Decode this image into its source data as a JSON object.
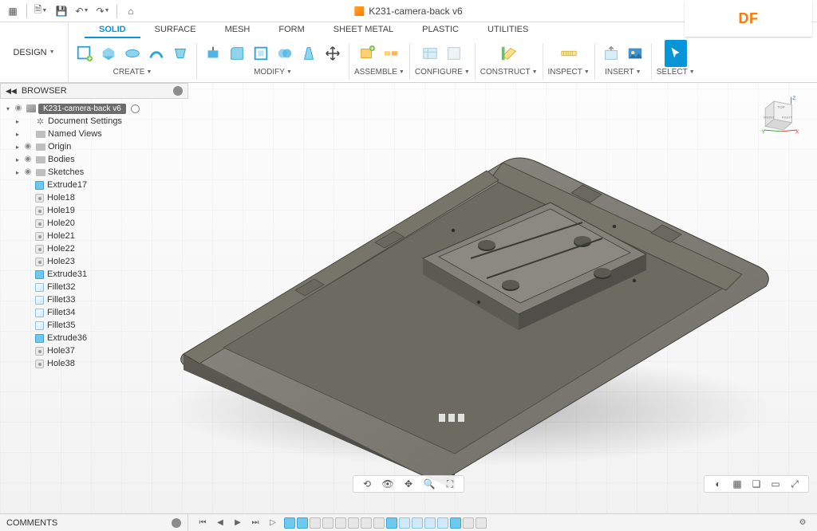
{
  "title": "K231-camera-back v6",
  "brand": "DF",
  "design_label": "DESIGN",
  "tabs": [
    "SOLID",
    "SURFACE",
    "MESH",
    "FORM",
    "SHEET METAL",
    "PLASTIC",
    "UTILITIES"
  ],
  "active_tab": 0,
  "groups": {
    "create": "CREATE",
    "modify": "MODIFY",
    "assemble": "ASSEMBLE",
    "configure": "CONFIGURE",
    "construct": "CONSTRUCT",
    "inspect": "INSPECT",
    "insert": "INSERT",
    "select": "SELECT"
  },
  "browser": {
    "title": "BROWSER",
    "root": "K231-camera-back v6",
    "nodes": [
      {
        "icon": "gear",
        "label": "Document Settings",
        "lvl": 1,
        "tri": true
      },
      {
        "icon": "folder",
        "label": "Named Views",
        "lvl": 1,
        "tri": true
      },
      {
        "icon": "folder",
        "label": "Origin",
        "lvl": 1,
        "tri": true,
        "eye": true
      },
      {
        "icon": "folder",
        "label": "Bodies",
        "lvl": 1,
        "tri": true,
        "eye": true
      },
      {
        "icon": "folder",
        "label": "Sketches",
        "lvl": 1,
        "tri": true,
        "eye": true
      },
      {
        "icon": "ext",
        "label": "Extrude17",
        "lvl": 2
      },
      {
        "icon": "hole",
        "label": "Hole18",
        "lvl": 2
      },
      {
        "icon": "hole",
        "label": "Hole19",
        "lvl": 2
      },
      {
        "icon": "hole",
        "label": "Hole20",
        "lvl": 2
      },
      {
        "icon": "hole",
        "label": "Hole21",
        "lvl": 2
      },
      {
        "icon": "hole",
        "label": "Hole22",
        "lvl": 2
      },
      {
        "icon": "hole",
        "label": "Hole23",
        "lvl": 2
      },
      {
        "icon": "ext",
        "label": "Extrude31",
        "lvl": 2
      },
      {
        "icon": "fillet",
        "label": "Fillet32",
        "lvl": 2
      },
      {
        "icon": "fillet",
        "label": "Fillet33",
        "lvl": 2
      },
      {
        "icon": "fillet",
        "label": "Fillet34",
        "lvl": 2
      },
      {
        "icon": "fillet",
        "label": "Fillet35",
        "lvl": 2
      },
      {
        "icon": "ext",
        "label": "Extrude36",
        "lvl": 2
      },
      {
        "icon": "hole",
        "label": "Hole37",
        "lvl": 2
      },
      {
        "icon": "hole",
        "label": "Hole38",
        "lvl": 2
      }
    ]
  },
  "viewcube": {
    "top": "TOP",
    "front": "FRONT",
    "right": "RIGHT",
    "axes": [
      "X",
      "Y",
      "Z"
    ]
  },
  "comments": "COMMENTS"
}
